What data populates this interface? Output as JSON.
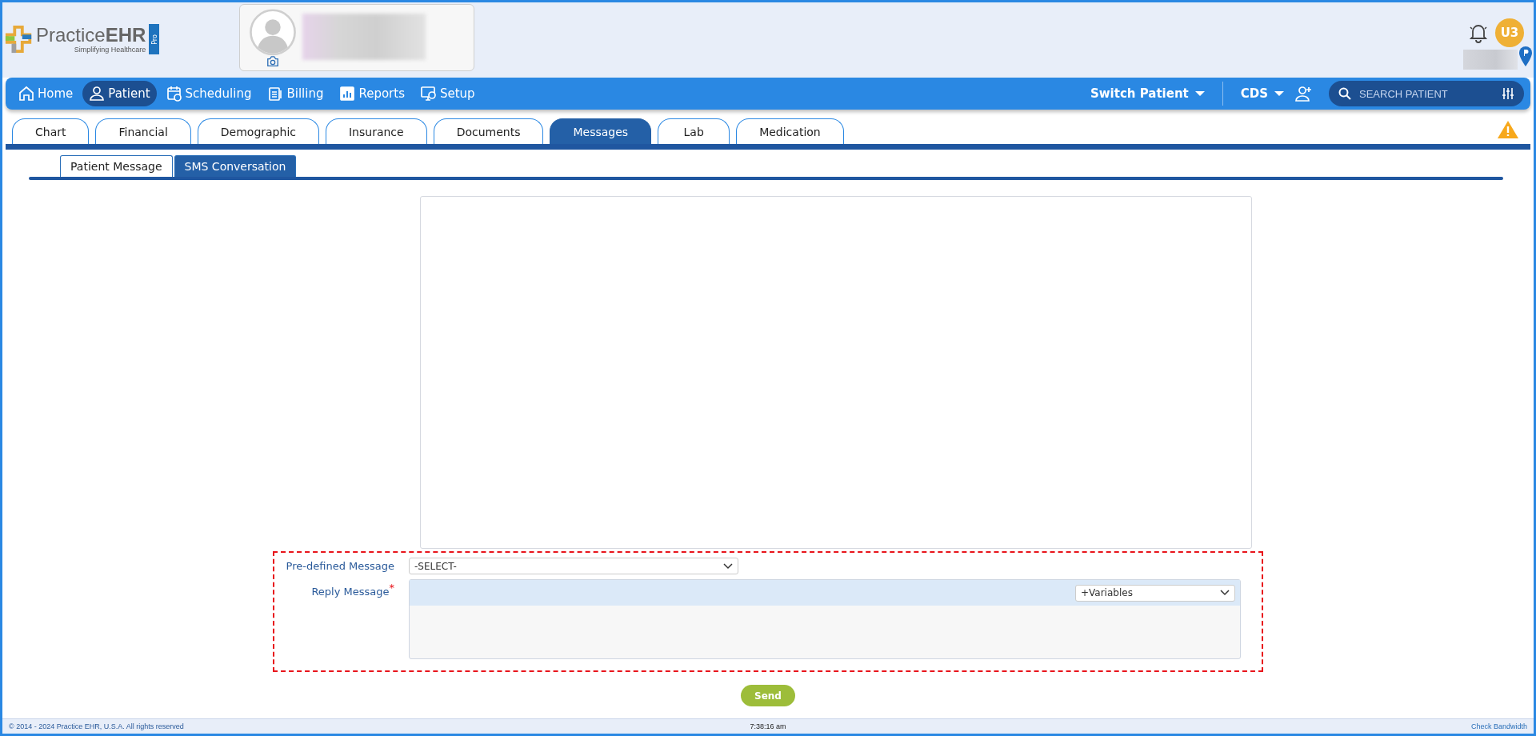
{
  "logo": {
    "wordmark": "Practice**EHR**",
    "tagline": "Simplifying Healthcare",
    "edition": "Pro"
  },
  "user_avatar": {
    "initials": "U3"
  },
  "nav": {
    "items": [
      {
        "label": "Home",
        "selected": false
      },
      {
        "label": "Patient",
        "selected": true
      },
      {
        "label": "Scheduling",
        "selected": false
      },
      {
        "label": "Billing",
        "selected": false
      },
      {
        "label": "Reports",
        "selected": false
      },
      {
        "label": "Setup",
        "selected": false
      }
    ],
    "switch_patient": "Switch Patient",
    "cds": "CDS",
    "search": {
      "placeholder": "SEARCH PATIENT"
    }
  },
  "tabs": [
    {
      "label": "Chart",
      "selected": false
    },
    {
      "label": "Financial",
      "selected": false
    },
    {
      "label": "Demographic",
      "selected": false
    },
    {
      "label": "Insurance",
      "selected": false
    },
    {
      "label": "Documents",
      "selected": false
    },
    {
      "label": "Messages",
      "selected": true
    },
    {
      "label": "Lab",
      "selected": false
    },
    {
      "label": "Medication",
      "selected": false
    }
  ],
  "subtabs": [
    {
      "label": "Patient Message",
      "selected": false
    },
    {
      "label": "SMS Conversation",
      "selected": true
    }
  ],
  "form": {
    "predefined_label": "Pre-defined Message",
    "predefined_value": "-SELECT-",
    "reply_label": "Reply Message",
    "required_mark": "*",
    "variables_value": "+Variables",
    "send": "Send"
  },
  "status_bar": {
    "copyright": "© 2014 - 2024 Practice EHR, U.S.A. All rights reserved",
    "time": "7:38:16 am",
    "link": "Check Bandwidth"
  }
}
